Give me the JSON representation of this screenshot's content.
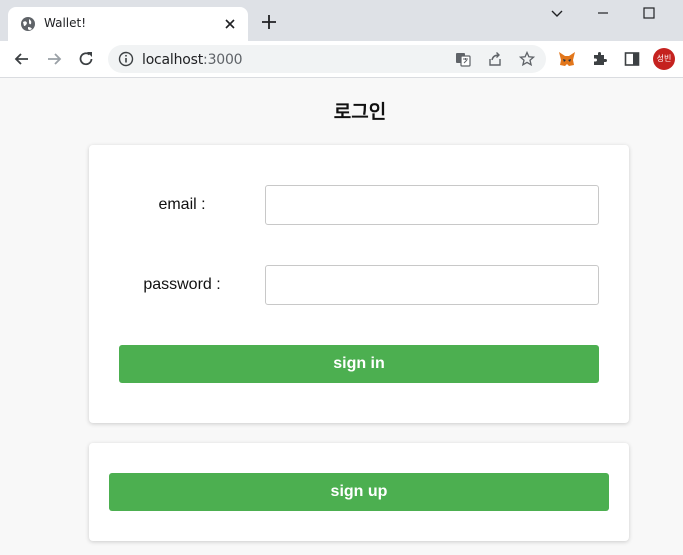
{
  "browser": {
    "tab_title": "Wallet!",
    "url_host": "localhost",
    "url_port": ":3000",
    "profile_initials": "성빈"
  },
  "page": {
    "title": "로그인"
  },
  "login_form": {
    "email_label": "email :",
    "email_value": "",
    "password_label": "password :",
    "password_value": "",
    "signin_label": "sign in"
  },
  "signup": {
    "signup_label": "sign up"
  },
  "colors": {
    "button": "#4caf50",
    "page_bg": "#f8f8f8",
    "avatar": "#c5221f"
  }
}
